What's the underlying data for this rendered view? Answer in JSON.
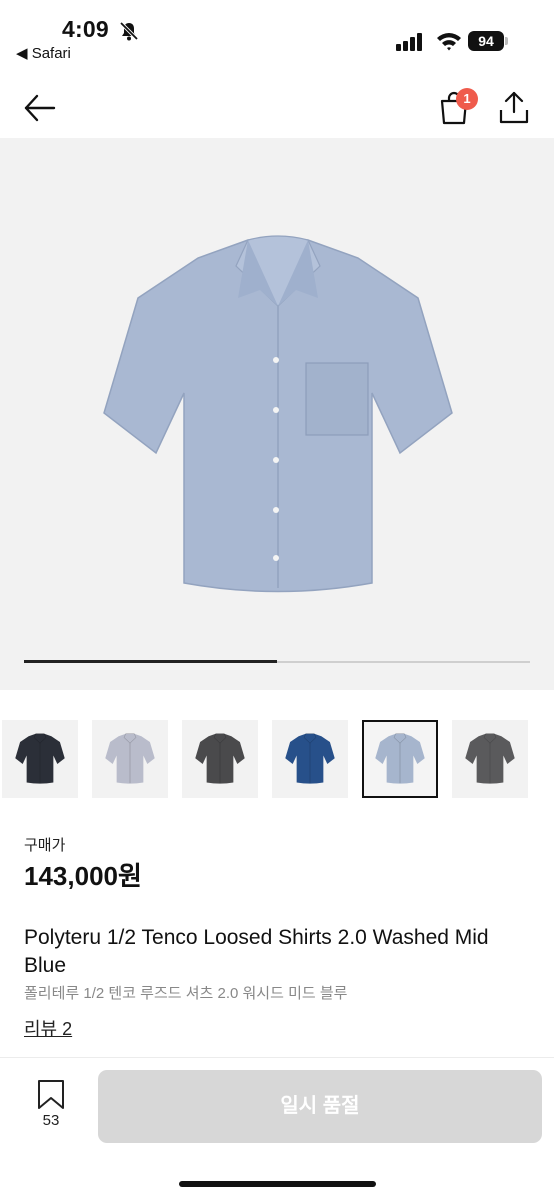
{
  "status_bar": {
    "time": "4:09",
    "back_app": "◀ Safari",
    "battery": "94"
  },
  "nav": {
    "cart_count": "1"
  },
  "gallery": {
    "progress": 0.5,
    "thumbnails": [
      {
        "color": "#2b2f38"
      },
      {
        "color": "#b9bccb"
      },
      {
        "color": "#4a4a4c"
      },
      {
        "color": "#27508a"
      },
      {
        "color": "#a6b5cd"
      },
      {
        "color": "#5a5a5c"
      }
    ],
    "selected_index": 4,
    "main_color": "#a9b8d2"
  },
  "product": {
    "price_label": "구매가",
    "price": "143,000원",
    "title_en": "Polyteru 1/2 Tenco Loosed Shirts 2.0 Washed Mid Blue",
    "title_ko": "폴리테루 1/2 텐코 루즈드 셔츠 2.0 워시드 미드 블루",
    "reviews": "리뷰 2"
  },
  "bottom_bar": {
    "save_count": "53",
    "buy_label": "일시 품절"
  },
  "colors": {
    "badge": "#ef5b4c",
    "button_disabled": "#d7d7d7"
  }
}
